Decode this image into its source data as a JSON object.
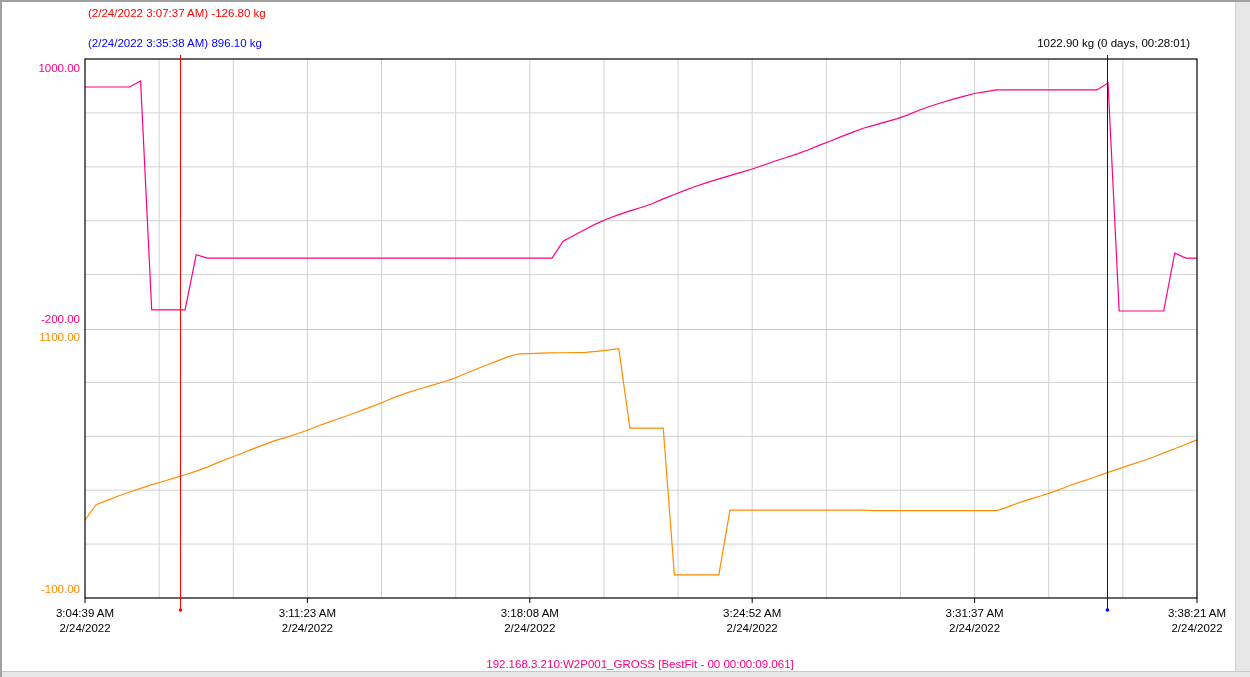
{
  "cursors": [
    {
      "readout": "(2/24/2022 3:07:37 AM) -126.80 kg",
      "color": "#ff0000",
      "level": 0.085
    },
    {
      "readout": "(2/24/2022 3:35:38 AM) 896.10 kg",
      "color": "#0000ff",
      "level": 0.919
    }
  ],
  "top_pane": {
    "chart_data": {
      "type": "line",
      "ylim": [
        -248,
        1043
      ],
      "yticks": [
        {
          "value": 1000,
          "label": "1000.00"
        },
        {
          "value": -200,
          "label": "-200.00"
        }
      ],
      "series": [
        {
          "color": "#ff0080",
          "values": [
            909,
            909,
            909,
            909,
            909,
            938,
            -157,
            -157,
            -157,
            -157,
            107,
            91,
            91,
            91,
            91,
            91,
            91,
            91,
            91,
            91,
            91,
            91,
            91,
            91,
            91,
            91,
            91,
            91,
            91,
            91,
            91,
            91,
            91,
            91,
            91,
            91,
            91,
            91,
            91,
            91,
            91,
            91,
            91,
            172,
            200,
            229,
            256,
            279,
            299,
            317,
            333,
            351,
            374,
            395,
            416,
            436,
            453,
            470,
            485,
            501,
            517,
            535,
            554,
            571,
            588,
            608,
            630,
            650,
            672,
            692,
            712,
            727,
            742,
            757,
            776,
            798,
            817,
            834,
            850,
            864,
            878,
            887,
            895,
            895,
            895,
            895,
            895,
            895,
            895,
            895,
            895,
            895,
            928,
            -162,
            -162,
            -162,
            -162,
            -162,
            115,
            91,
            91
          ]
        }
      ],
      "annotations": [
        "1022.90 kg (0 days, 00:28:01)"
      ]
    }
  },
  "bottom_pane": {
    "chart_data": {
      "type": "line",
      "ylim": [
        -143,
        1138
      ],
      "yticks": [
        {
          "value": 1100,
          "label": "1100.00"
        },
        {
          "value": -100,
          "label": "-100.00"
        }
      ],
      "categories": [
        "3:04:39 AM\n2/24/2022",
        null,
        null,
        null,
        null,
        null,
        null,
        null,
        null,
        null,
        null,
        null,
        null,
        null,
        null,
        null,
        null,
        null,
        null,
        null,
        "3:11:23 AM\n2/24/2022",
        null,
        null,
        null,
        null,
        null,
        null,
        null,
        null,
        null,
        null,
        null,
        null,
        null,
        null,
        null,
        null,
        null,
        null,
        null,
        "3:18:08 AM\n2/24/2022",
        null,
        null,
        null,
        null,
        null,
        null,
        null,
        null,
        null,
        null,
        null,
        null,
        null,
        null,
        null,
        null,
        null,
        null,
        null,
        "3:24:52 AM\n2/24/2022",
        null,
        null,
        null,
        null,
        null,
        null,
        null,
        null,
        null,
        null,
        null,
        null,
        null,
        null,
        null,
        null,
        null,
        null,
        null,
        "3:31:37 AM\n2/24/2022",
        null,
        null,
        null,
        null,
        null,
        null,
        null,
        null,
        null,
        null,
        null,
        null,
        null,
        null,
        null,
        null,
        null,
        null,
        null,
        "3:38:21 AM\n2/24/2022"
      ],
      "series": [
        {
          "color": "#ff8c00",
          "values": [
            229,
            301,
            322,
            343,
            362,
            379,
            397,
            412,
            428,
            444,
            461,
            480,
            503,
            524,
            544,
            565,
            585,
            605,
            621,
            638,
            656,
            677,
            696,
            714,
            733,
            753,
            773,
            794,
            816,
            835,
            851,
            867,
            882,
            899,
            921,
            943,
            964,
            984,
            1005,
            1020,
            1021,
            1023,
            1024,
            1025,
            1026,
            1027,
            1031,
            1037,
            1044,
            666,
            666,
            666,
            666,
            -33,
            -33,
            -33,
            -33,
            -33,
            275,
            275,
            275,
            275,
            275,
            275,
            275,
            275,
            275,
            275,
            275,
            275,
            275,
            273,
            273,
            273,
            273,
            273,
            273,
            273,
            273,
            273,
            273,
            273,
            273,
            291,
            311,
            328,
            344,
            361,
            381,
            401,
            418,
            437,
            455,
            473,
            491,
            508,
            526,
            548,
            568,
            589,
            610
          ]
        }
      ]
    }
  },
  "caption": "192.168.3.210:W2P001_GROSS [BestFit - 00 00:00:09.061]"
}
